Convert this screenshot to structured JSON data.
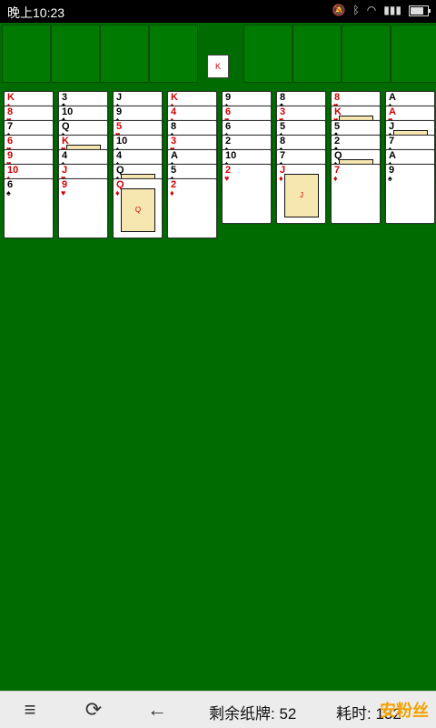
{
  "status": {
    "time": "晚上10:23",
    "icons": [
      "mute-icon",
      "bluetooth-icon",
      "wifi-icon",
      "signal-icon",
      "battery-icon"
    ]
  },
  "top": {
    "slots": 4,
    "foundation": 4,
    "center_badge": "K"
  },
  "tableau": [
    [
      {
        "r": "K",
        "s": "♠",
        "c": "red",
        "face": false
      },
      {
        "r": "8",
        "s": "♥",
        "c": "red",
        "face": false
      },
      {
        "r": "7",
        "s": "♠",
        "c": "black",
        "face": false
      },
      {
        "r": "6",
        "s": "♥",
        "c": "red",
        "face": false
      },
      {
        "r": "9",
        "s": "♥",
        "c": "red",
        "face": false
      },
      {
        "r": "10",
        "s": "♦",
        "c": "red",
        "face": false
      },
      {
        "r": "6",
        "s": "♠",
        "c": "black",
        "face": false
      }
    ],
    [
      {
        "r": "3",
        "s": "♣",
        "c": "black",
        "face": false
      },
      {
        "r": "10",
        "s": "♣",
        "c": "black",
        "face": false
      },
      {
        "r": "Q",
        "s": "♠",
        "c": "black",
        "face": false
      },
      {
        "r": "K",
        "s": "♥",
        "c": "red",
        "face": true
      },
      {
        "r": "4",
        "s": "♠",
        "c": "black",
        "face": false
      },
      {
        "r": "J",
        "s": "♥",
        "c": "red",
        "face": false
      },
      {
        "r": "9",
        "s": "♥",
        "c": "red",
        "face": false
      }
    ],
    [
      {
        "r": "J",
        "s": "♠",
        "c": "black",
        "face": false
      },
      {
        "r": "9",
        "s": "♠",
        "c": "black",
        "face": false
      },
      {
        "r": "5",
        "s": "♥",
        "c": "red",
        "face": false
      },
      {
        "r": "10",
        "s": "♠",
        "c": "black",
        "face": false
      },
      {
        "r": "4",
        "s": "♠",
        "c": "black",
        "face": false
      },
      {
        "r": "Q",
        "s": "♠",
        "c": "black",
        "face": true
      },
      {
        "r": "Q",
        "s": "♦",
        "c": "red",
        "face": true
      }
    ],
    [
      {
        "r": "K",
        "s": "♦",
        "c": "red",
        "face": false
      },
      {
        "r": "4",
        "s": "♦",
        "c": "red",
        "face": false
      },
      {
        "r": "8",
        "s": "♠",
        "c": "black",
        "face": false
      },
      {
        "r": "3",
        "s": "♥",
        "c": "red",
        "face": false
      },
      {
        "r": "A",
        "s": "♠",
        "c": "black",
        "face": false
      },
      {
        "r": "5",
        "s": "♠",
        "c": "black",
        "face": false
      },
      {
        "r": "2",
        "s": "♦",
        "c": "red",
        "face": false
      }
    ],
    [
      {
        "r": "9",
        "s": "♠",
        "c": "black",
        "face": false
      },
      {
        "r": "6",
        "s": "♥",
        "c": "red",
        "face": false
      },
      {
        "r": "6",
        "s": "♠",
        "c": "black",
        "face": false
      },
      {
        "r": "2",
        "s": "♠",
        "c": "black",
        "face": false
      },
      {
        "r": "10",
        "s": "♠",
        "c": "black",
        "face": false
      },
      {
        "r": "2",
        "s": "♥",
        "c": "red",
        "face": false
      }
    ],
    [
      {
        "r": "8",
        "s": "♣",
        "c": "black",
        "face": false
      },
      {
        "r": "3",
        "s": "♥",
        "c": "red",
        "face": false
      },
      {
        "r": "5",
        "s": "♠",
        "c": "black",
        "face": false
      },
      {
        "r": "8",
        "s": "♠",
        "c": "black",
        "face": false
      },
      {
        "r": "7",
        "s": "♠",
        "c": "black",
        "face": false
      },
      {
        "r": "J",
        "s": "♦",
        "c": "red",
        "face": true
      }
    ],
    [
      {
        "r": "8",
        "s": "♥",
        "c": "red",
        "face": false
      },
      {
        "r": "K",
        "s": "♥",
        "c": "red",
        "face": true
      },
      {
        "r": "5",
        "s": "♣",
        "c": "black",
        "face": false
      },
      {
        "r": "2",
        "s": "♣",
        "c": "black",
        "face": false
      },
      {
        "r": "Q",
        "s": "♠",
        "c": "black",
        "face": true
      },
      {
        "r": "7",
        "s": "♦",
        "c": "red",
        "face": false
      }
    ],
    [
      {
        "r": "A",
        "s": "♠",
        "c": "black",
        "face": false
      },
      {
        "r": "A",
        "s": "♥",
        "c": "red",
        "face": false
      },
      {
        "r": "J",
        "s": "♠",
        "c": "black",
        "face": true
      },
      {
        "r": "7",
        "s": "♠",
        "c": "black",
        "face": false
      },
      {
        "r": "A",
        "s": "♠",
        "c": "black",
        "face": false
      },
      {
        "r": "9",
        "s": "♠",
        "c": "black",
        "face": false
      }
    ]
  ],
  "bottom": {
    "remaining_label": "剩余纸牌: 52",
    "time_label": "耗时: 132",
    "watermark": "安粉丝"
  }
}
